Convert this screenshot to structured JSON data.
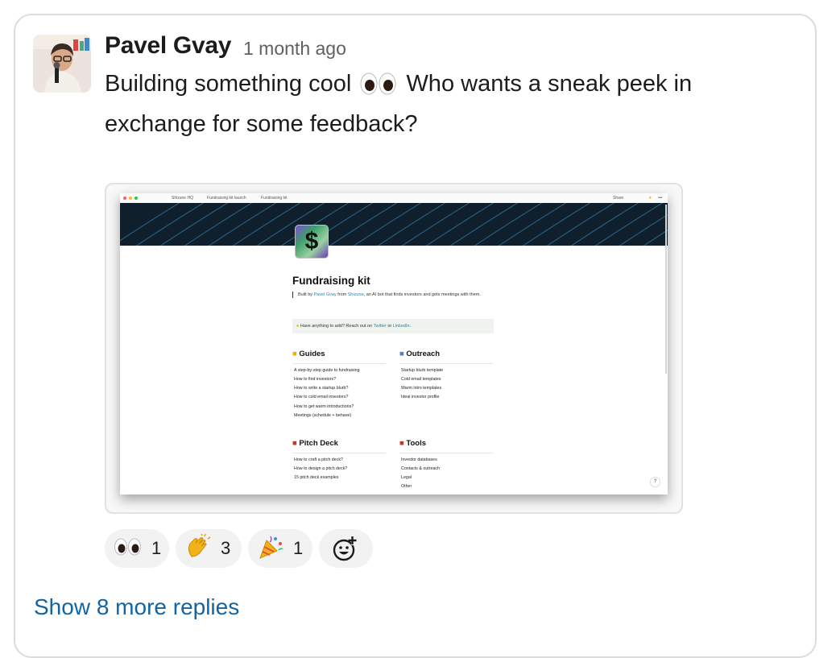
{
  "message": {
    "author": "Pavel Gvay",
    "timestamp": "1 month ago",
    "text_before": "Building something cool",
    "text_after": "Who wants a sneak peek in exchange for some feedback?"
  },
  "attachment": {
    "breadcrumbs": [
      "Shizune HQ",
      "Fundraising kit launch",
      "Fundraising kit"
    ],
    "topbar_share": "Share",
    "page_title": "Fundraising kit",
    "quote_prefix": "Built by",
    "quote_author": "Pavel Gvay",
    "quote_from": "from",
    "quote_company": "Shizune",
    "quote_rest": ", an AI bot that finds investors and gets meetings with them.",
    "callout_prefix": "Have anything to add? Reach out on",
    "callout_twitter": "Twitter",
    "callout_or": "or",
    "callout_linkedin": "LinkedIn.",
    "sections": {
      "guides": {
        "title": "Guides",
        "items": [
          "A step-by-step guide to fundraising",
          "How to find investors?",
          "How to write a startup blurb?",
          "How to cold email investors?",
          "How to get warm introductions?",
          "Meetings (schedule + behave)"
        ]
      },
      "outreach": {
        "title": "Outreach",
        "items": [
          "Startup blurb template",
          "Cold email templates",
          "Warm intro templates",
          "Ideal investor profile"
        ]
      },
      "pitch": {
        "title": "Pitch Deck",
        "items": [
          "How to craft a pitch deck?",
          "How to design a pitch deck?",
          "15 pitch deck examples"
        ]
      },
      "tools": {
        "title": "Tools",
        "items": [
          "Investor databases",
          "Contacts & outreach",
          "Legal",
          "Other"
        ]
      }
    },
    "help": "?"
  },
  "reactions": [
    {
      "emoji": "eyes",
      "count": "1"
    },
    {
      "emoji": "clapping-hands",
      "count": "3"
    },
    {
      "emoji": "party-popper",
      "count": "1"
    }
  ],
  "add_reaction_icon": "add-emoji-icon",
  "show_more": "Show 8 more replies",
  "colors": {
    "link": "#1264a3",
    "pill_bg": "#f2f2f2",
    "card_border": "#dcdcdc"
  }
}
